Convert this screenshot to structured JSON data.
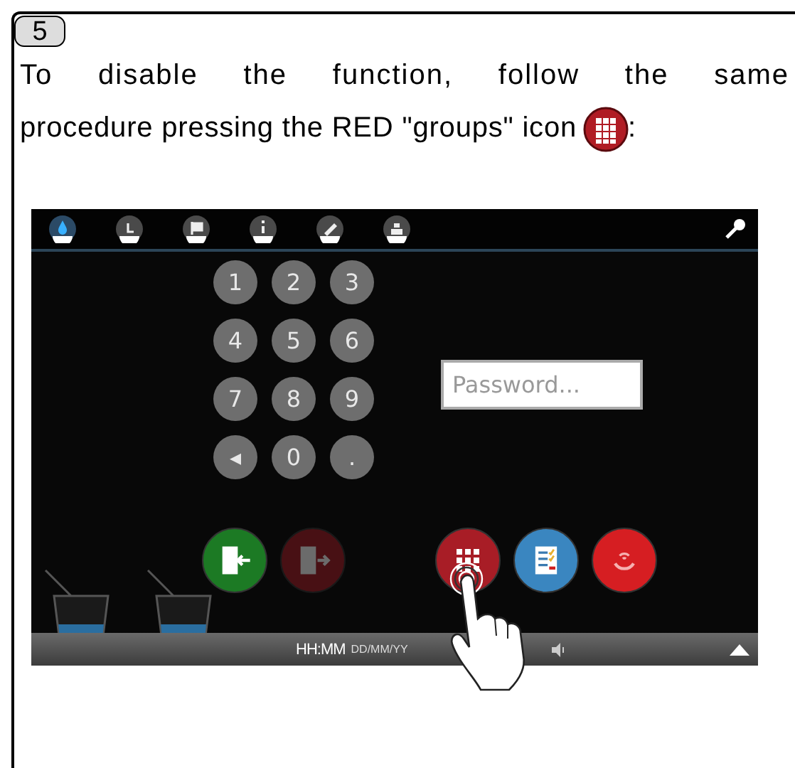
{
  "step": "5",
  "instruction": {
    "lines": [
      "To disable the function, follow the same",
      "procedure pressing the RED \"groups\" icon"
    ],
    "ending": ":"
  },
  "screen": {
    "toolbar": [
      {
        "selected": true
      },
      {
        "selected": false
      },
      {
        "selected": false
      },
      {
        "selected": false
      },
      {
        "selected": false
      },
      {
        "selected": false
      }
    ],
    "keypad": [
      "1",
      "2",
      "3",
      "4",
      "5",
      "6",
      "7",
      "8",
      "9",
      "◂",
      "0",
      "."
    ],
    "password": {
      "placeholder": "Password..."
    },
    "door_buttons": [
      {
        "disabled": false
      },
      {
        "disabled": true
      }
    ],
    "status_bar": {
      "time": "HH:MM",
      "date": "DD/MM/YY"
    }
  }
}
